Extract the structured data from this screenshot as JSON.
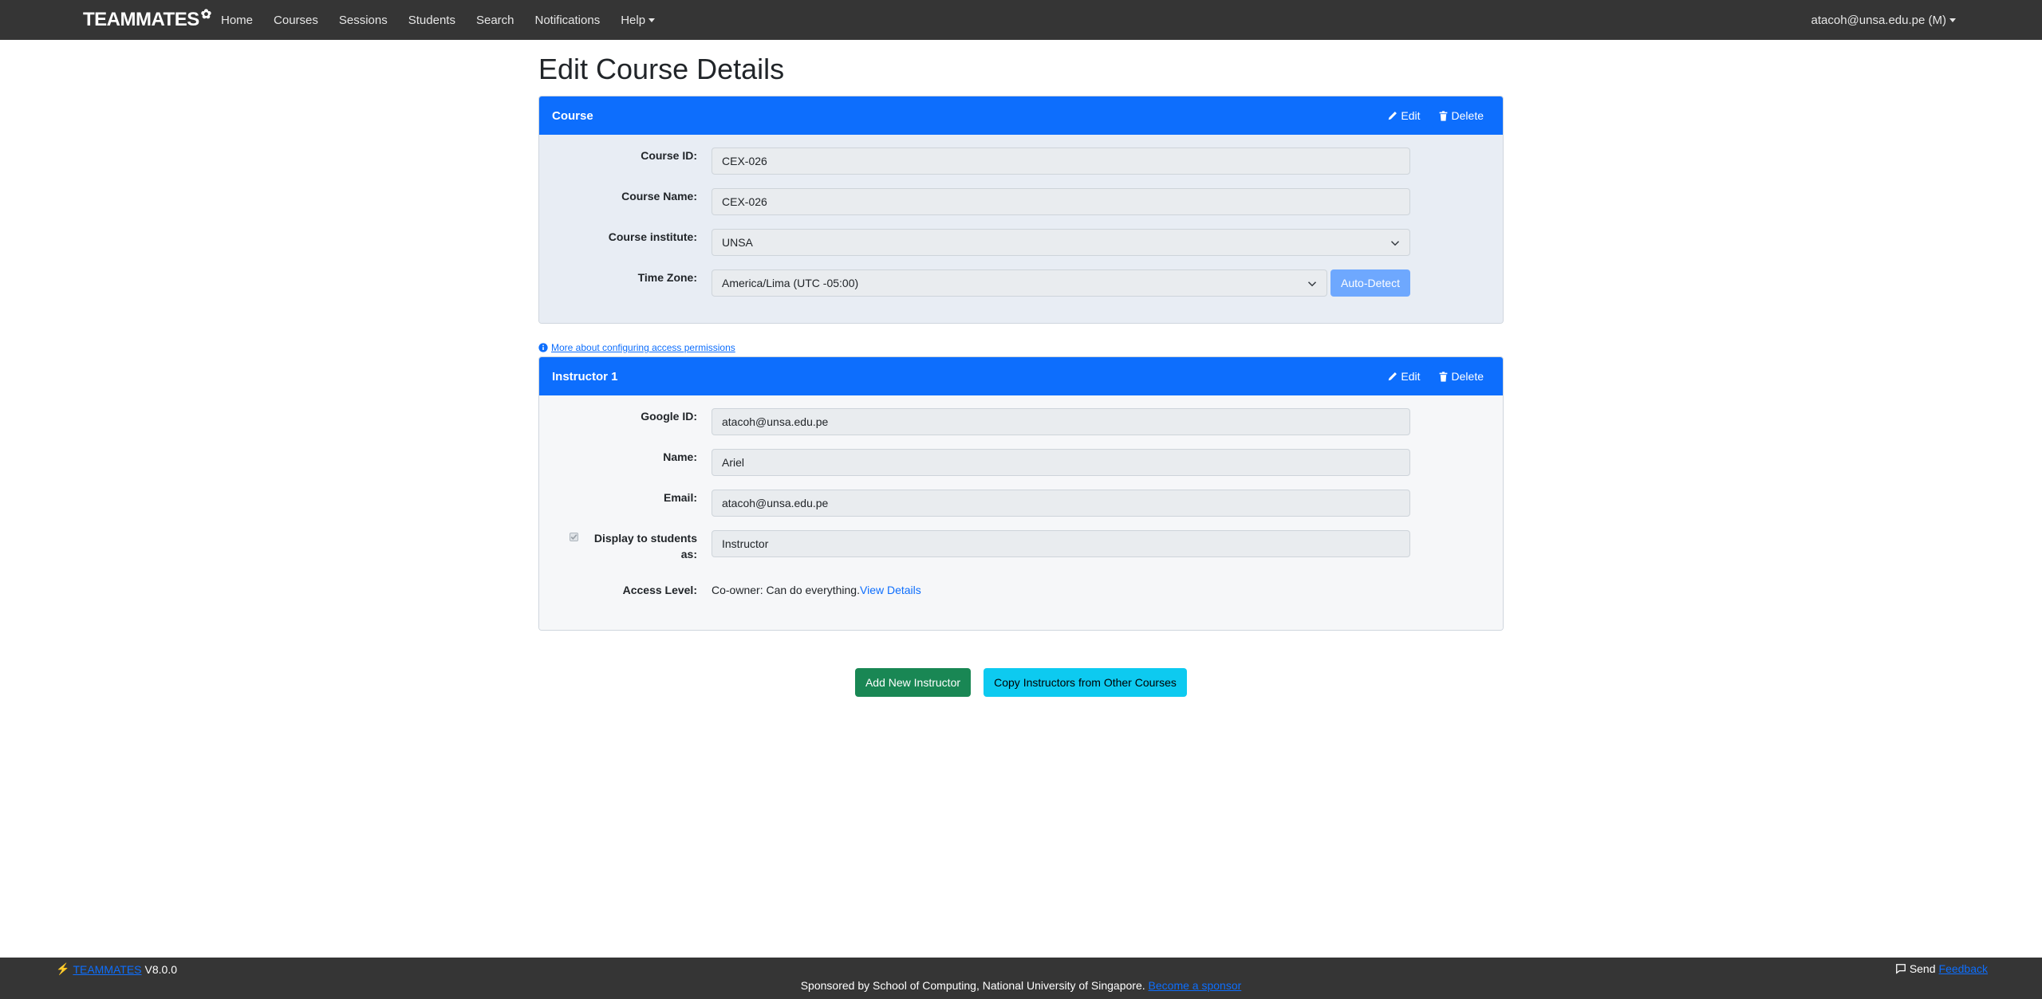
{
  "navbar": {
    "brand": "TEAMMATES",
    "items": [
      {
        "label": "Home"
      },
      {
        "label": "Courses"
      },
      {
        "label": "Sessions"
      },
      {
        "label": "Students"
      },
      {
        "label": "Search"
      },
      {
        "label": "Notifications"
      },
      {
        "label": "Help"
      }
    ],
    "user": "atacoh@unsa.edu.pe (M)"
  },
  "page": {
    "title": "Edit Course Details"
  },
  "course_card": {
    "title": "Course",
    "edit_label": "Edit",
    "delete_label": "Delete",
    "fields": {
      "course_id": {
        "label": "Course ID:",
        "value": "CEX-026"
      },
      "course_name": {
        "label": "Course Name:",
        "value": "CEX-026"
      },
      "institute": {
        "label": "Course institute:",
        "value": "UNSA"
      },
      "time_zone": {
        "label": "Time Zone:",
        "value": "America/Lima (UTC -05:00)"
      }
    },
    "auto_detect_label": "Auto-Detect"
  },
  "access_link": "More about configuring access permissions",
  "instructor_card": {
    "title": "Instructor 1",
    "edit_label": "Edit",
    "delete_label": "Delete",
    "fields": {
      "google_id": {
        "label": "Google ID:",
        "value": "atacoh@unsa.edu.pe"
      },
      "name": {
        "label": "Name:",
        "value": "Ariel"
      },
      "email": {
        "label": "Email:",
        "value": "atacoh@unsa.edu.pe"
      },
      "display_as": {
        "label_line1": "Display to students",
        "label_line2": "as:",
        "value": "Instructor",
        "checked": true
      }
    },
    "access_level": {
      "label": "Access Level:",
      "value": "Co-owner: Can do everything.",
      "link": "View Details"
    }
  },
  "actions": {
    "add_instructor": "Add New Instructor",
    "copy_instructors": "Copy Instructors from Other Courses"
  },
  "footer": {
    "app_name": "TEAMMATES",
    "version": "V8.0.0",
    "sponsor_text": "Sponsored by School of Computing, National University of Singapore.",
    "sponsor_link": "Become a sponsor",
    "send_label": "Send",
    "feedback_link": "Feedback"
  },
  "colors": {
    "navbar": "#353535",
    "primary": "#0d6efd",
    "success": "#198754",
    "info": "#0dcaf0"
  }
}
